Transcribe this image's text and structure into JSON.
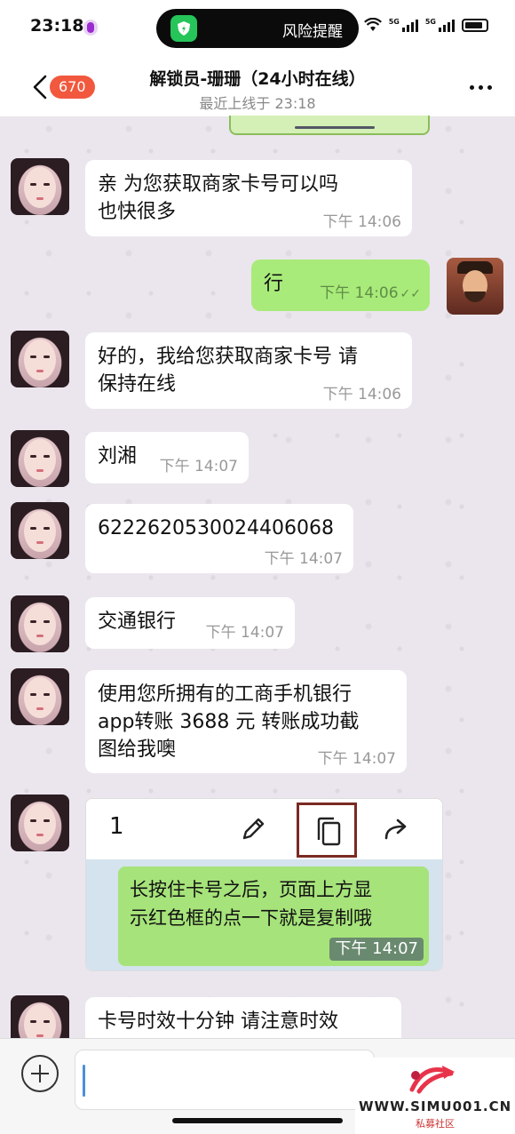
{
  "status_bar": {
    "time": "23:18",
    "risk_label": "风险提醒",
    "signal_label": "5G"
  },
  "header": {
    "unread_count": "670",
    "title": "解锁员-珊珊（24小时在线）",
    "subtitle": "最近上线于 23:18"
  },
  "messages": [
    {
      "side": "in",
      "text": "亲  为您获取商家卡号可以吗也快很多",
      "line1": "亲  为您获取商家卡号可以吗",
      "line2": "也快很多",
      "time": "下午 14:06"
    },
    {
      "side": "out",
      "text": "行",
      "time": "下午 14:06"
    },
    {
      "side": "in",
      "line1": "好的，我给您获取商家卡号 请",
      "line2": "保持在线",
      "time": "下午 14:06"
    },
    {
      "side": "in",
      "text": "刘湘",
      "time": "下午 14:07"
    },
    {
      "side": "in",
      "text": "6222620530024406068",
      "time": "下午 14:07"
    },
    {
      "side": "in",
      "text": "交通银行",
      "time": "下午 14:07"
    },
    {
      "side": "in",
      "line1": "使用您所拥有的工商手机银行",
      "line2": "app转账  3688 元 转账成功截",
      "line3": "图给我噢",
      "time": "下午 14:07"
    },
    {
      "side": "in",
      "type": "image",
      "toolbar_number": "1",
      "line1": "长按住卡号之后，页面上方显",
      "line2": "示红色框的点一下就是复制哦",
      "time": "下午 14:07"
    },
    {
      "side": "in",
      "line1": "卡号时效十分钟 请注意时效"
    }
  ],
  "watermark": {
    "url": "WWW.SIMU001.CN",
    "sub": "私募社区"
  },
  "colors": {
    "outgoing_bubble": "#a9eb7a",
    "badge": "#f2583e",
    "highlight_box": "#7a2a22"
  }
}
